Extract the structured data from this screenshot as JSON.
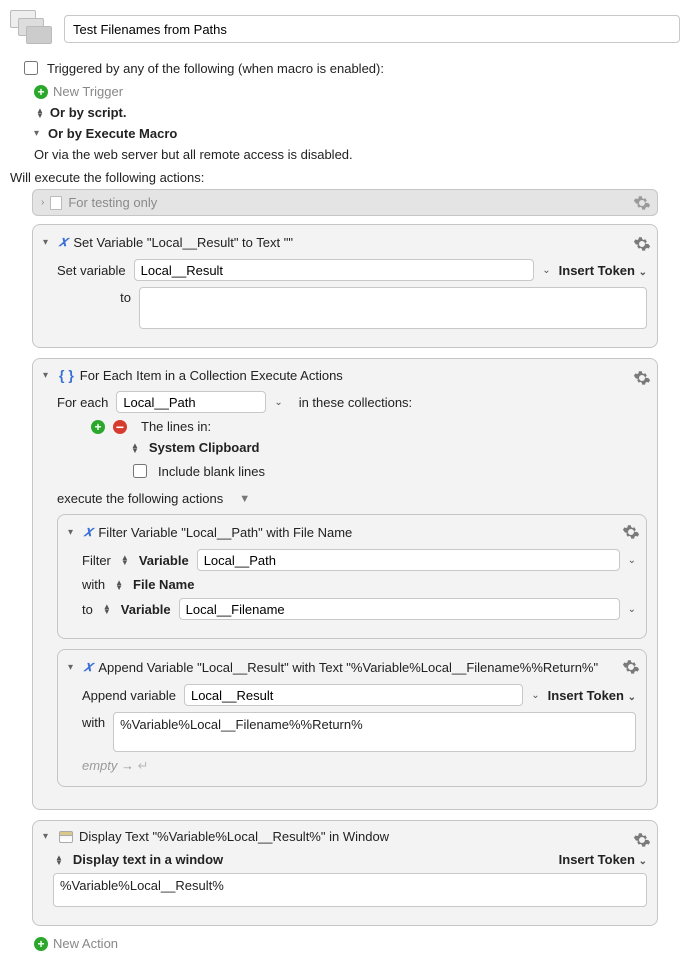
{
  "header": {
    "title": "Test Filenames from Paths"
  },
  "triggers": {
    "checkbox_label": "Triggered by any of the following (when macro is enabled):",
    "new_trigger": "New Trigger",
    "or_script": "Or by script.",
    "or_execute_macro": "Or by Execute Macro",
    "web_server": "Or via the web server but all remote access is disabled."
  },
  "will_execute": "Will execute the following actions:",
  "testing_only": "For testing only",
  "action_set_var": {
    "title": "Set Variable \"Local__Result\" to Text \"\"",
    "set_variable_label": "Set variable",
    "variable_name": "Local__Result",
    "insert_token": "Insert Token",
    "to_label": "to",
    "to_value": ""
  },
  "action_foreach": {
    "title": "For Each Item in a Collection Execute Actions",
    "for_each_label": "For each",
    "var_name": "Local__Path",
    "in_collections_label": "in these collections:",
    "lines_in_label": "The lines in:",
    "source": "System Clipboard",
    "include_blank": "Include blank lines",
    "execute_label": "execute the following actions",
    "filter": {
      "title": "Filter Variable \"Local__Path\" with File Name",
      "filter_label": "Filter",
      "variable_kw": "Variable",
      "filter_var": "Local__Path",
      "with_label": "with",
      "with_value": "File Name",
      "to_label": "to",
      "to_variable_kw": "Variable",
      "to_var": "Local__Filename"
    },
    "append": {
      "title": "Append Variable \"Local__Result\" with Text \"%Variable%Local__Filename%%Return%\"",
      "append_label": "Append variable",
      "append_var": "Local__Result",
      "insert_token": "Insert Token",
      "with_label": "with",
      "with_value": "%Variable%Local__Filename%%Return%",
      "hint_prefix": "empty",
      "hint_arrow": "→",
      "hint_return": "↵"
    }
  },
  "action_display": {
    "title": "Display Text \"%Variable%Local__Result%\" in Window",
    "display_label": "Display text in a window",
    "insert_token": "Insert Token",
    "value": "%Variable%Local__Result%"
  },
  "new_action": "New Action"
}
